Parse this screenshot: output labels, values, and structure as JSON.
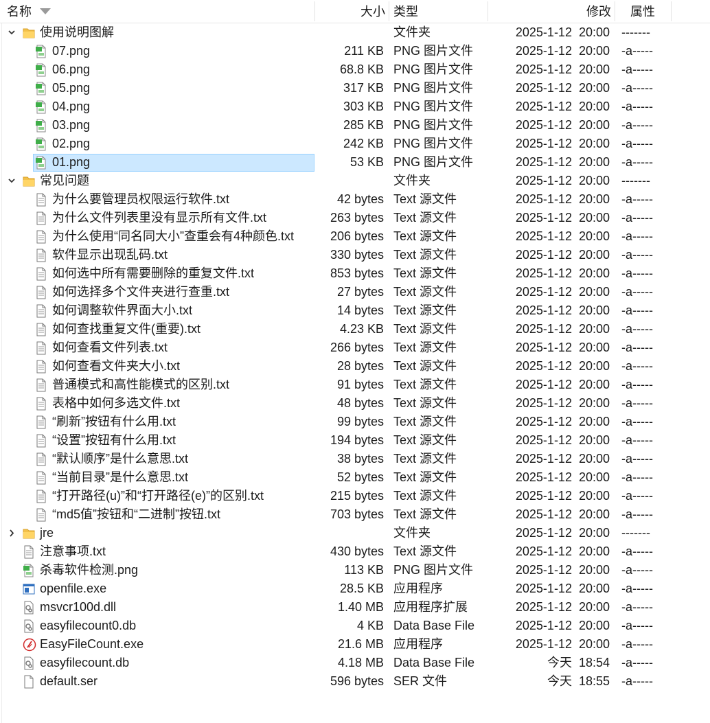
{
  "header": {
    "name_label": "名称",
    "size_label": "大小",
    "type_label": "类型",
    "modified_label": "修改",
    "attr_label": "属性"
  },
  "rows": [
    {
      "name": "使用说明图解",
      "size": "",
      "type": "文件夹",
      "date": "2025-1-12  20:00",
      "attr": "-------",
      "level": 0,
      "icon": "folder-icon",
      "expand": "expanded"
    },
    {
      "name": "07.png",
      "size": "211 KB",
      "type": "PNG 图片文件",
      "date": "2025-1-12  20:00",
      "attr": "-a-----",
      "level": 1,
      "icon": "png-file-icon"
    },
    {
      "name": "06.png",
      "size": "68.8 KB",
      "type": "PNG 图片文件",
      "date": "2025-1-12  20:00",
      "attr": "-a-----",
      "level": 1,
      "icon": "png-file-icon"
    },
    {
      "name": "05.png",
      "size": "317 KB",
      "type": "PNG 图片文件",
      "date": "2025-1-12  20:00",
      "attr": "-a-----",
      "level": 1,
      "icon": "png-file-icon"
    },
    {
      "name": "04.png",
      "size": "303 KB",
      "type": "PNG 图片文件",
      "date": "2025-1-12  20:00",
      "attr": "-a-----",
      "level": 1,
      "icon": "png-file-icon"
    },
    {
      "name": "03.png",
      "size": "285 KB",
      "type": "PNG 图片文件",
      "date": "2025-1-12  20:00",
      "attr": "-a-----",
      "level": 1,
      "icon": "png-file-icon"
    },
    {
      "name": "02.png",
      "size": "242 KB",
      "type": "PNG 图片文件",
      "date": "2025-1-12  20:00",
      "attr": "-a-----",
      "level": 1,
      "icon": "png-file-icon"
    },
    {
      "name": "01.png",
      "size": "53 KB",
      "type": "PNG 图片文件",
      "date": "2025-1-12  20:00",
      "attr": "-a-----",
      "level": 1,
      "icon": "png-file-icon",
      "selected": true
    },
    {
      "name": "常见问题",
      "size": "",
      "type": "文件夹",
      "date": "2025-1-12  20:00",
      "attr": "-------",
      "level": 0,
      "icon": "folder-icon",
      "expand": "expanded"
    },
    {
      "name": "为什么要管理员权限运行软件.txt",
      "size": "42 bytes",
      "type": "Text 源文件",
      "date": "2025-1-12  20:00",
      "attr": "-a-----",
      "level": 1,
      "icon": "text-file-icon"
    },
    {
      "name": "为什么文件列表里没有显示所有文件.txt",
      "size": "263 bytes",
      "type": "Text 源文件",
      "date": "2025-1-12  20:00",
      "attr": "-a-----",
      "level": 1,
      "icon": "text-file-icon"
    },
    {
      "name": "为什么使用“同名同大小”查重会有4种颜色.txt",
      "size": "206 bytes",
      "type": "Text 源文件",
      "date": "2025-1-12  20:00",
      "attr": "-a-----",
      "level": 1,
      "icon": "text-file-icon"
    },
    {
      "name": "软件显示出现乱码.txt",
      "size": "330 bytes",
      "type": "Text 源文件",
      "date": "2025-1-12  20:00",
      "attr": "-a-----",
      "level": 1,
      "icon": "text-file-icon"
    },
    {
      "name": "如何选中所有需要删除的重复文件.txt",
      "size": "853 bytes",
      "type": "Text 源文件",
      "date": "2025-1-12  20:00",
      "attr": "-a-----",
      "level": 1,
      "icon": "text-file-icon"
    },
    {
      "name": "如何选择多个文件夹进行查重.txt",
      "size": "27 bytes",
      "type": "Text 源文件",
      "date": "2025-1-12  20:00",
      "attr": "-a-----",
      "level": 1,
      "icon": "text-file-icon"
    },
    {
      "name": "如何调整软件界面大小.txt",
      "size": "14 bytes",
      "type": "Text 源文件",
      "date": "2025-1-12  20:00",
      "attr": "-a-----",
      "level": 1,
      "icon": "text-file-icon"
    },
    {
      "name": "如何查找重复文件(重要).txt",
      "size": "4.23 KB",
      "type": "Text 源文件",
      "date": "2025-1-12  20:00",
      "attr": "-a-----",
      "level": 1,
      "icon": "text-file-icon"
    },
    {
      "name": "如何查看文件列表.txt",
      "size": "266 bytes",
      "type": "Text 源文件",
      "date": "2025-1-12  20:00",
      "attr": "-a-----",
      "level": 1,
      "icon": "text-file-icon"
    },
    {
      "name": "如何查看文件夹大小.txt",
      "size": "28 bytes",
      "type": "Text 源文件",
      "date": "2025-1-12  20:00",
      "attr": "-a-----",
      "level": 1,
      "icon": "text-file-icon"
    },
    {
      "name": "普通模式和高性能模式的区别.txt",
      "size": "91 bytes",
      "type": "Text 源文件",
      "date": "2025-1-12  20:00",
      "attr": "-a-----",
      "level": 1,
      "icon": "text-file-icon"
    },
    {
      "name": "表格中如何多选文件.txt",
      "size": "48 bytes",
      "type": "Text 源文件",
      "date": "2025-1-12  20:00",
      "attr": "-a-----",
      "level": 1,
      "icon": "text-file-icon"
    },
    {
      "name": "“刷新”按钮有什么用.txt",
      "size": "99 bytes",
      "type": "Text 源文件",
      "date": "2025-1-12  20:00",
      "attr": "-a-----",
      "level": 1,
      "icon": "text-file-icon"
    },
    {
      "name": "“设置”按钮有什么用.txt",
      "size": "194 bytes",
      "type": "Text 源文件",
      "date": "2025-1-12  20:00",
      "attr": "-a-----",
      "level": 1,
      "icon": "text-file-icon"
    },
    {
      "name": "“默认顺序”是什么意思.txt",
      "size": "38 bytes",
      "type": "Text 源文件",
      "date": "2025-1-12  20:00",
      "attr": "-a-----",
      "level": 1,
      "icon": "text-file-icon"
    },
    {
      "name": "“当前目录”是什么意思.txt",
      "size": "52 bytes",
      "type": "Text 源文件",
      "date": "2025-1-12  20:00",
      "attr": "-a-----",
      "level": 1,
      "icon": "text-file-icon"
    },
    {
      "name": "“打开路径(u)”和“打开路径(e)”的区别.txt",
      "size": "215 bytes",
      "type": "Text 源文件",
      "date": "2025-1-12  20:00",
      "attr": "-a-----",
      "level": 1,
      "icon": "text-file-icon"
    },
    {
      "name": "“md5值”按钮和“二进制”按钮.txt",
      "size": "703 bytes",
      "type": "Text 源文件",
      "date": "2025-1-12  20:00",
      "attr": "-a-----",
      "level": 1,
      "icon": "text-file-icon"
    },
    {
      "name": "jre",
      "size": "",
      "type": "文件夹",
      "date": "2025-1-12  20:00",
      "attr": "-------",
      "level": 0,
      "icon": "folder-icon",
      "expand": "collapsed"
    },
    {
      "name": "注意事项.txt",
      "size": "430 bytes",
      "type": "Text 源文件",
      "date": "2025-1-12  20:00",
      "attr": "-a-----",
      "level": 0,
      "icon": "text-file-icon"
    },
    {
      "name": "杀毒软件检测.png",
      "size": "113 KB",
      "type": "PNG 图片文件",
      "date": "2025-1-12  20:00",
      "attr": "-a-----",
      "level": 0,
      "icon": "png-file-icon"
    },
    {
      "name": "openfile.exe",
      "size": "28.5 KB",
      "type": "应用程序",
      "date": "2025-1-12  20:00",
      "attr": "-a-----",
      "level": 0,
      "icon": "exe-window-icon"
    },
    {
      "name": "msvcr100d.dll",
      "size": "1.40 MB",
      "type": "应用程序扩展",
      "date": "2025-1-12  20:00",
      "attr": "-a-----",
      "level": 0,
      "icon": "dll-file-icon"
    },
    {
      "name": "easyfilecount0.db",
      "size": "4 KB",
      "type": "Data Base File",
      "date": "2025-1-12  20:00",
      "attr": "-a-----",
      "level": 0,
      "icon": "db-file-icon"
    },
    {
      "name": "EasyFileCount.exe",
      "size": "21.6 MB",
      "type": "应用程序",
      "date": "2025-1-12  20:00",
      "attr": "-a-----",
      "level": 0,
      "icon": "easyfilecount-app-icon"
    },
    {
      "name": "easyfilecount.db",
      "size": "4.18 MB",
      "type": "Data Base File",
      "date": "今天  18:54",
      "attr": "-a-----",
      "level": 0,
      "icon": "db-file-icon"
    },
    {
      "name": "default.ser",
      "size": "596 bytes",
      "type": "SER 文件",
      "date": "今天  18:55",
      "attr": "-a-----",
      "level": 0,
      "icon": "blank-file-icon"
    }
  ]
}
